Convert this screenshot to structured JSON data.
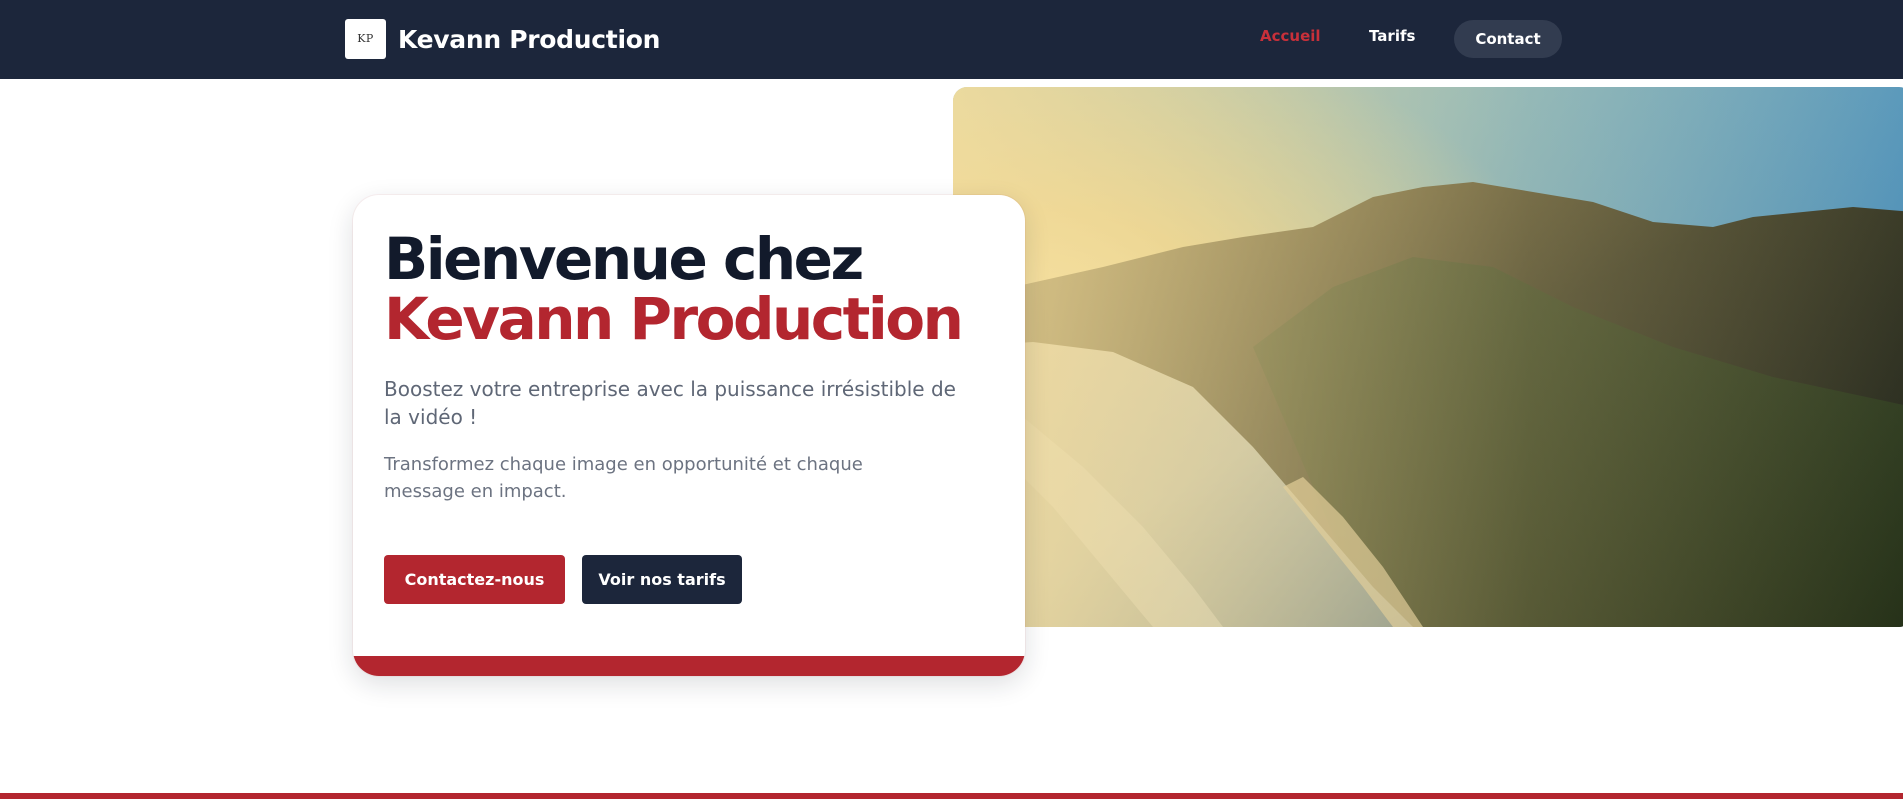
{
  "navbar": {
    "logo_text": "KP",
    "brand_name": "Kevann Production",
    "links": [
      {
        "label": "Accueil",
        "active": true
      },
      {
        "label": "Tarifs",
        "active": false
      }
    ],
    "contact_label": "Contact"
  },
  "hero": {
    "heading_line1": "Bienvenue chez",
    "heading_line2": "Kevann Production",
    "subtitle": "Boostez votre entreprise avec la puissance irrésistible de la vidéo !",
    "tagline": "Transformez chaque image en opportunité et chaque message en impact.",
    "primary_button": "Contactez-nous",
    "secondary_button": "Voir nos tarifs",
    "image": "coastal-mountain-landscape"
  },
  "colors": {
    "navbar_bg": "#1c263b",
    "accent_red": "#b3262f",
    "dark_navy": "#121a2b"
  }
}
